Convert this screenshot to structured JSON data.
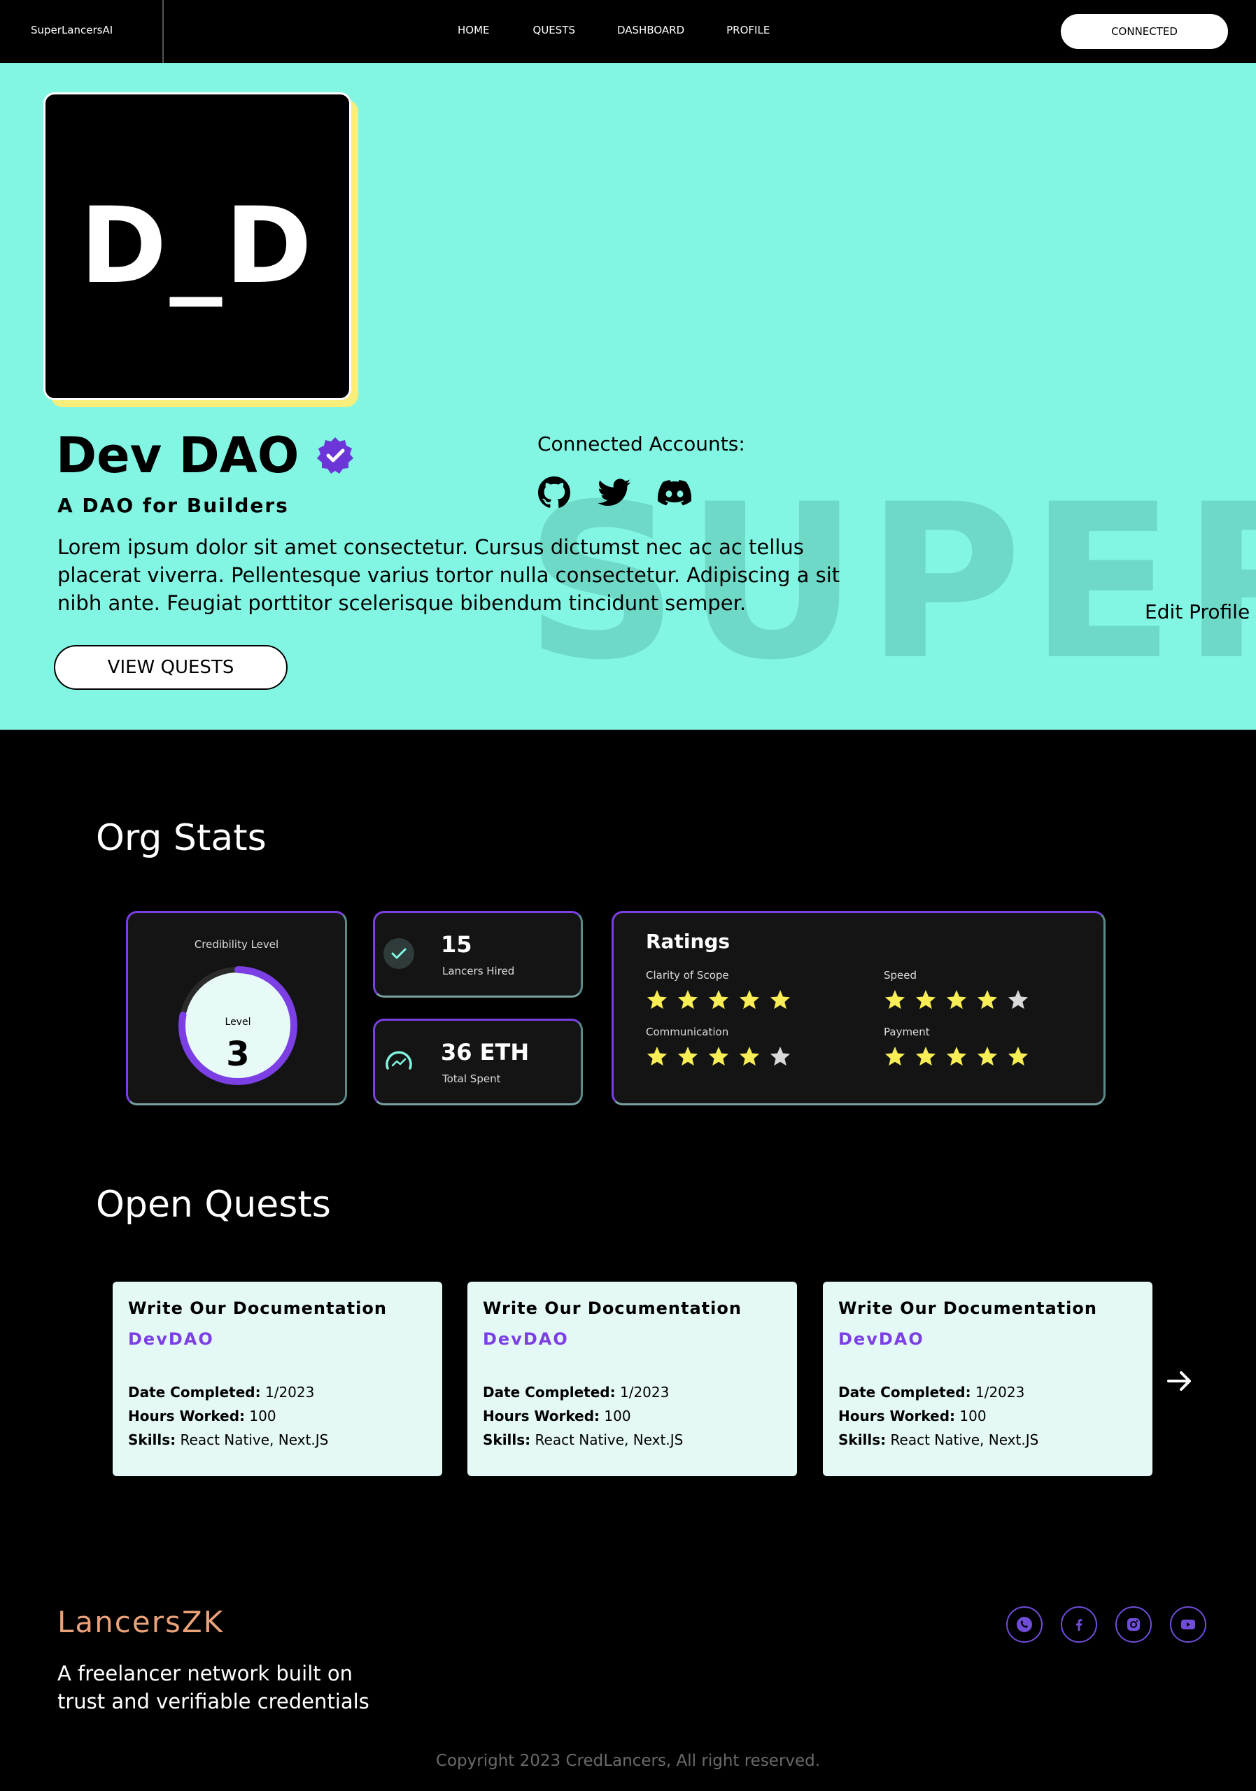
{
  "nav": {
    "brand": "SuperLancersAI",
    "links": [
      "HOME",
      "QUESTS",
      "DASHBOARD",
      "PROFILE"
    ],
    "button": "CONNECTED"
  },
  "hero": {
    "avatar_text": "D_D",
    "org_name": "Dev DAO",
    "tagline": "A DAO for Builders",
    "description": "Lorem ipsum dolor sit amet consectetur. Cursus dictumst nec ac ac tellus placerat viverra. Pellentesque varius tortor nulla consectetur. Adipiscing a sit nibh ante. Feugiat porttitor scelerisque bibendum tincidunt semper.",
    "view_button": "VIEW QUESTS",
    "connected_label": "Connected Accounts:",
    "social_icons": [
      "github-icon",
      "twitter-icon",
      "discord-icon"
    ],
    "watermark": "SUPER",
    "edit_profile": "Edit Profile",
    "background_color": "#82f6e2"
  },
  "stats": {
    "title": "Org Stats",
    "credibility": {
      "label": "Credibility Level",
      "level_label": "Level",
      "level": "3",
      "progress": 0.78
    },
    "hired": {
      "value": "15",
      "label": "Lancers Hired"
    },
    "spent": {
      "value": "36 ETH",
      "label": "Total Spent"
    },
    "ratings": {
      "title": "Ratings",
      "items": [
        {
          "label": "Clarity of Scope",
          "stars": 5
        },
        {
          "label": "Speed",
          "stars": 4
        },
        {
          "label": "Communication",
          "stars": 4
        },
        {
          "label": "Payment",
          "stars": 5
        }
      ]
    },
    "accent_color": "#7b3fe4"
  },
  "quests": {
    "title": "Open Quests",
    "items": [
      {
        "title": "Write Our Documentation",
        "org": "DevDAO",
        "date_label": "Date Completed:",
        "date": "1/2023",
        "hours_label": "Hours Worked:",
        "hours": "100",
        "skills_label": "Skills:",
        "skills": "React Native, Next.JS"
      },
      {
        "title": "Write Our Documentation",
        "org": "DevDAO",
        "date_label": "Date Completed:",
        "date": "1/2023",
        "hours_label": "Hours Worked:",
        "hours": "100",
        "skills_label": "Skills:",
        "skills": "React Native, Next.JS"
      },
      {
        "title": "Write Our Documentation",
        "org": "DevDAO",
        "date_label": "Date Completed:",
        "date": "1/2023",
        "hours_label": "Hours Worked:",
        "hours": "100",
        "skills_label": "Skills:",
        "skills": "React Native, Next.JS"
      }
    ]
  },
  "footer": {
    "logo": "LancersZK",
    "tagline": "A freelancer network built on trust and verifiable credentials",
    "social_icons": [
      "phone-icon",
      "facebook-icon",
      "instagram-icon",
      "youtube-icon"
    ],
    "copyright": "Copyright 2023 CredLancers, All right reserved."
  }
}
